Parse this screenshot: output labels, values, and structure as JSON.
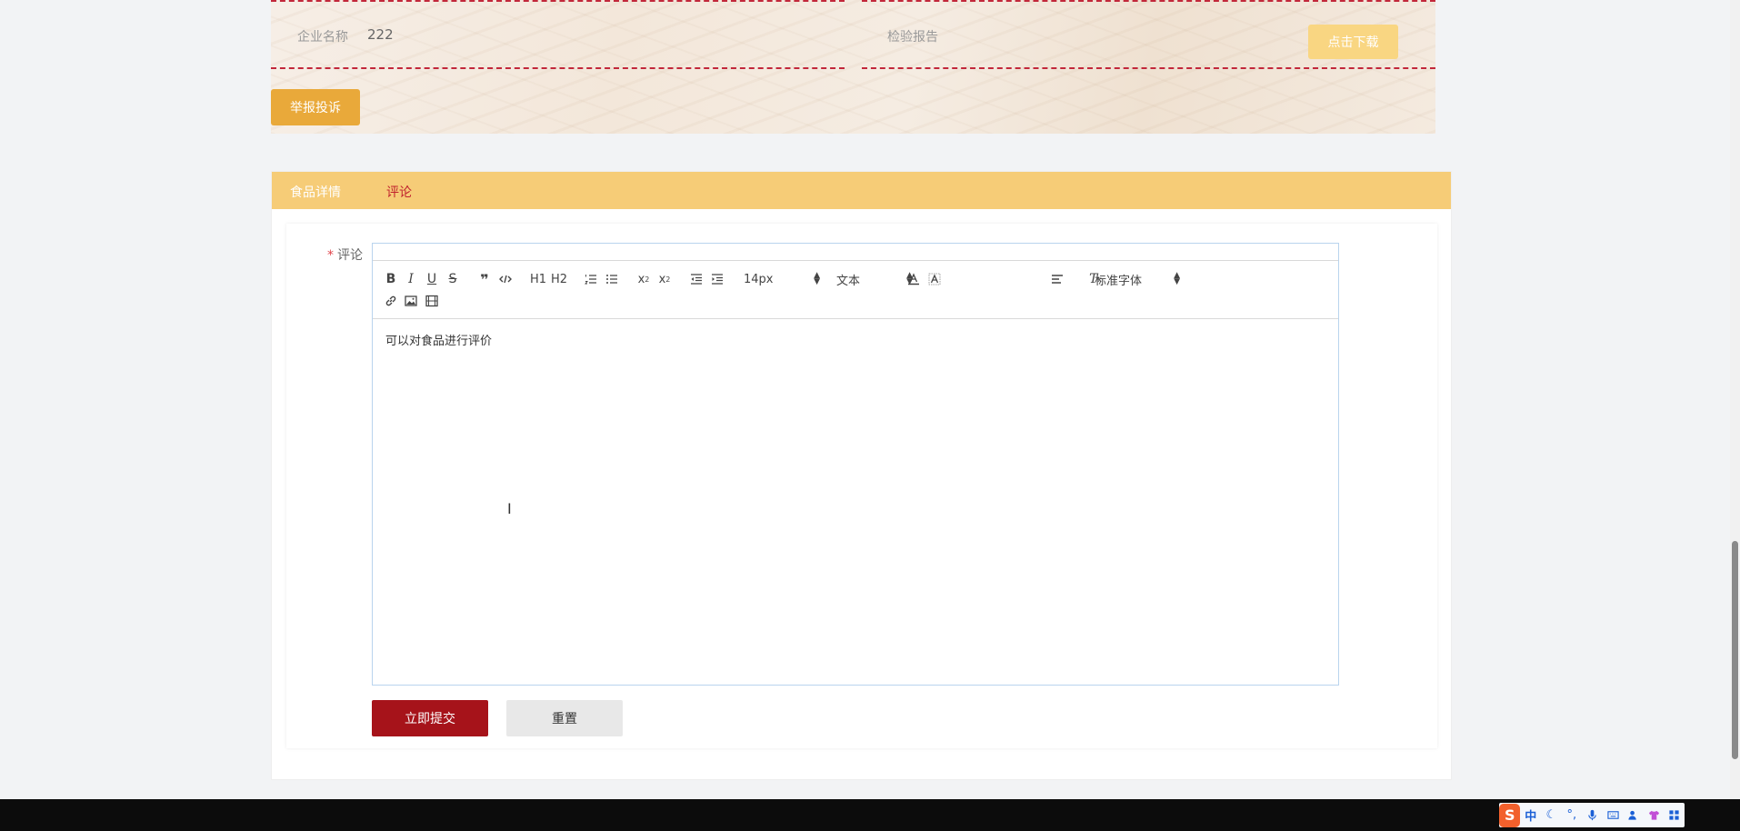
{
  "info": {
    "company_label": "企业名称",
    "company_value": "222",
    "report_label": "检验报告",
    "download_label": "点击下载",
    "report_button_label": "举报投诉"
  },
  "tabs": [
    {
      "label": "食品详情",
      "active": false
    },
    {
      "label": "评论",
      "active": true
    }
  ],
  "comment_form": {
    "required_mark": "*",
    "field_label": "评论",
    "placeholder": "可以对食品进行评价",
    "toolbar": {
      "font_size": "14px",
      "header_type": "文本",
      "font_family": "标准字体",
      "h1": "H1",
      "h2": "H2"
    },
    "submit_label": "立即提交",
    "reset_label": "重置"
  },
  "taskbar": {
    "ime_logo": "S",
    "ime_mode": "中",
    "ime_punct": "°,"
  },
  "colors": {
    "accent_red": "#a6131a",
    "tab_bar": "#f6cc77",
    "report_button": "#e9a93a",
    "download_button": "#f9d682"
  }
}
